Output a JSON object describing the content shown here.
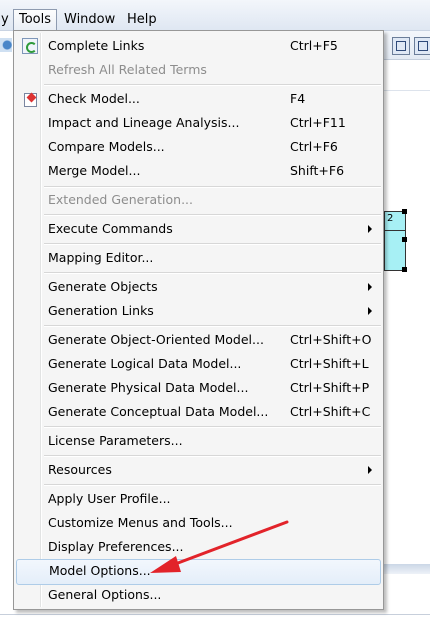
{
  "menubar": {
    "items": [
      "y",
      "Tools",
      "Window",
      "Help"
    ]
  },
  "tools_menu": {
    "items": [
      {
        "label": "Complete Links",
        "shortcut": "Ctrl+F5",
        "icon": "refresh-icon"
      },
      {
        "label": "Refresh All Related Terms",
        "disabled": true
      },
      {
        "label": "Check Model...",
        "shortcut": "F4",
        "icon": "check-model-icon"
      },
      {
        "label": "Impact and Lineage Analysis...",
        "shortcut": "Ctrl+F11"
      },
      {
        "label": "Compare Models...",
        "shortcut": "Ctrl+F6"
      },
      {
        "label": "Merge Model...",
        "shortcut": "Shift+F6"
      },
      {
        "label": "Extended Generation...",
        "disabled": true
      },
      {
        "label": "Execute Commands",
        "submenu": true
      },
      {
        "label": "Mapping Editor..."
      },
      {
        "label": "Generate Objects",
        "submenu": true
      },
      {
        "label": "Generation Links",
        "submenu": true
      },
      {
        "label": "Generate Object-Oriented Model...",
        "shortcut": "Ctrl+Shift+O"
      },
      {
        "label": "Generate Logical Data Model...",
        "shortcut": "Ctrl+Shift+L"
      },
      {
        "label": "Generate Physical Data Model...",
        "shortcut": "Ctrl+Shift+P"
      },
      {
        "label": "Generate Conceptual Data Model...",
        "shortcut": "Ctrl+Shift+C"
      },
      {
        "label": "License Parameters..."
      },
      {
        "label": "Resources",
        "submenu": true
      },
      {
        "label": "Apply User Profile..."
      },
      {
        "label": "Customize Menus and Tools..."
      },
      {
        "label": "Display Preferences..."
      },
      {
        "label": "Model Options...",
        "highlighted": true
      },
      {
        "label": "General Options..."
      }
    ]
  },
  "canvas": {
    "entity_text": "2"
  },
  "colors": {
    "highlight_border": "#aecce8",
    "annotation_arrow": "#e2232a",
    "entity_fill": "#a7f0f5"
  }
}
